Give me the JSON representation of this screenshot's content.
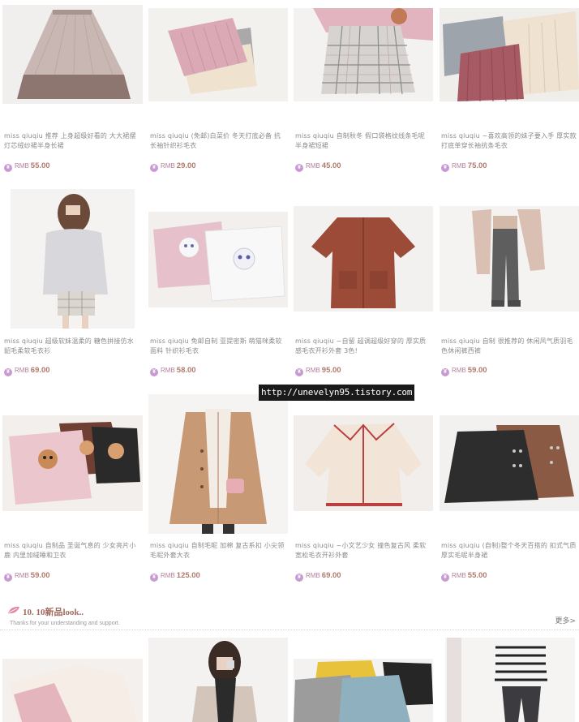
{
  "watermark": "http://unevelyn95.tistory.com",
  "currency_label": "RMB",
  "currency_icon": "yen-icon",
  "products": [
    {
      "title": "miss qiuqiu 推荐 上身超级好看的 大大裙摆灯芯绒纱裙半身长裙",
      "price": "55.00"
    },
    {
      "title": "miss qiuqiu (免邮)白菜价 冬天打底必备 抗长袖针织衫毛衣",
      "price": "29.00"
    },
    {
      "title": "miss qiuqiu 自制秋冬 假口袋格纹线条毛呢半身裙短裙",
      "price": "45.00"
    },
    {
      "title": "miss qiuqiu ~喜欢高领的妹子要入手 厚实款打底单穿长袖抗条毛衣",
      "price": "75.00"
    },
    {
      "title": "miss qiuqiu 超级软妹温柔的 糖色拼接仿水貂毛柔软毛衣衫",
      "price": "69.00"
    },
    {
      "title": "miss qiuqiu 免邮自制 亚提密斯 萌猫咪柔软面料 针织衫毛衣",
      "price": "58.00"
    },
    {
      "title": "miss qiuqiu ~自留 超调超级好穿的 厚实质感毛衣开衫外套 3色!",
      "price": "95.00"
    },
    {
      "title": "miss qiuqiu 自制 很推荐的 休闲风气质羽毛色休闲裤西裤",
      "price": "59.00"
    },
    {
      "title": "miss qiuqiu 自制品 圣诞气息的 少女亮片小鹿 内里加绒睡和卫衣",
      "price": "59.00"
    },
    {
      "title": "miss qiuqiu 自制毛呢 加棉 复古系扣 小尖领毛呢外套大衣",
      "price": "125.00"
    },
    {
      "title": "miss qiuqiu ~小文艺少女 撞色复古风 柔软宽松毛衣开衫外套",
      "price": "69.00"
    },
    {
      "title": "miss qiuqiu (自制)整个冬天百搭的 扣式气质厚实毛呢半身裙",
      "price": "55.00"
    }
  ],
  "section": {
    "title": "10. 10新品look..",
    "subtitle": "Thanks for your understanding and support.",
    "more": "更多>"
  }
}
